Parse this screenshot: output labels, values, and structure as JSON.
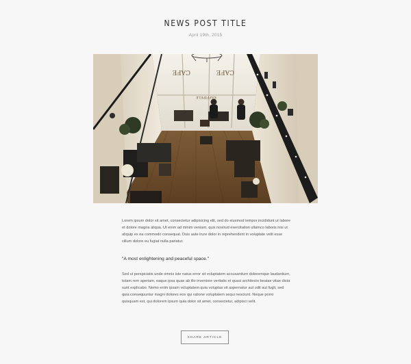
{
  "post": {
    "title": "NEWS POST TITLE",
    "date": "April 19th, 2015",
    "image_sign_left": "CAFE",
    "image_sign_right": "CAFE",
    "image_sign_sub": "KAFFIPELE",
    "paragraph_1": "Lorem ipsum dolor sit amet, consectetur adipisicing elit, sed do eiusmod tempor incididunt ut labore et dolore magna aliqua. Ut enim ad minim veniam, quis nostrud exercitation ullamco laboris nisi ut aliquip ex ea commodo consequat. Duis aute irure dolor in reprehenderit in voluptate velit esse cillum dolore eu fugiat nulla pariatur.",
    "quote": "\"A most enlightening and peaceful space.\"",
    "paragraph_2": "Sed ut perspiciatis unde omnis iste natus error sit voluptatem accusantium doloremque laudantium, totam rem aperiam, eaque ipsa quae ab illo inventore veritatis et quasi architecto beatae vitae dicta sunt explicabo. Nemo enim ipsam voluptatem quia voluptas sit aspernatur aut odit aut fugit, sed quia consequuntur magni dolores eos qui ratione voluptatem sequi nesciunt. Neque porro quisquam est, qui dolorem ipsum quia dolor sit amet, consectetur, adipisci velit.",
    "share_label": "SHARE ARTICLE"
  },
  "colors": {
    "background": "#f7f7f8",
    "title": "#2c2c2c",
    "date": "#9a9a9a",
    "body": "#555555",
    "button_border": "#8a8a8a"
  }
}
